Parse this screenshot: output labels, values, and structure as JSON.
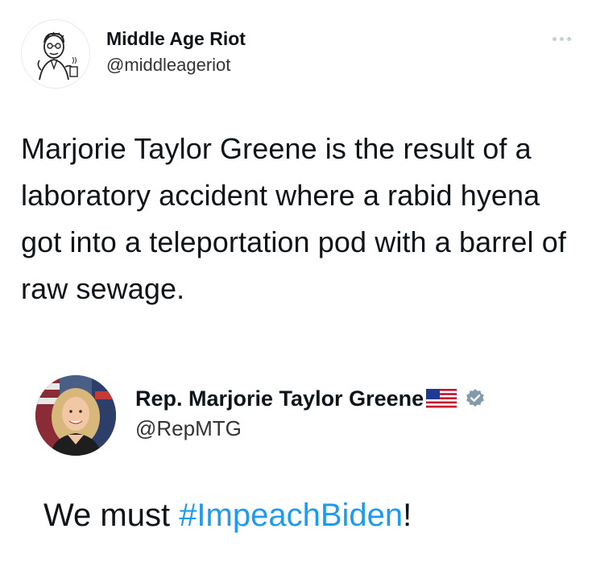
{
  "tweet": {
    "display_name": "Middle Age Riot",
    "handle": "@middleageriot",
    "text": "Marjorie Taylor Greene is the result of a laboratory accident where a rabid hyena got into a teleportation pod with a barrel of raw sewage.",
    "avatar_icon": "cartoon-man-avatar",
    "more_icon": "more-options-icon"
  },
  "quoted": {
    "display_name": "Rep. Marjorie Taylor Greene",
    "handle": "@RepMTG",
    "text_before": "We must ",
    "hashtag": "#ImpeachBiden",
    "text_after": "!",
    "flag_icon": "us-flag-icon",
    "verified_icon": "verified-badge-icon"
  },
  "colors": {
    "text": "#0f1419",
    "secondary_text": "#333333",
    "hashtag": "#1d9bf0",
    "verified": "#829aab"
  }
}
